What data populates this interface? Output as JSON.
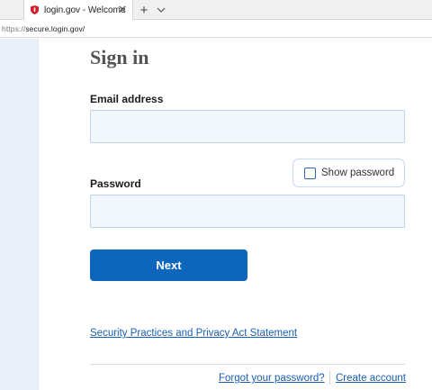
{
  "browser": {
    "tab_title": "login.gov - Welcome",
    "tab_close": "✕",
    "new_tab": "+",
    "url_scheme": "https://",
    "url_host": "secure.login.gov/"
  },
  "page": {
    "heading": "Sign in",
    "email_label": "Email address",
    "email_value": "",
    "password_label": "Password",
    "password_value": "",
    "show_password_label": "Show password",
    "next_button": "Next",
    "security_link": "Security Practices and Privacy Act Statement",
    "forgot_link": "Forgot your password?",
    "create_link": "Create account"
  },
  "colors": {
    "accent": "#0d66bc",
    "link": "#1a5fb4",
    "favicon": "#d11f2b",
    "input_bg": "#f1f7fd",
    "side_strip": "#eaf0f7"
  },
  "icons": {
    "favicon": "shield-icon",
    "tab_close": "close-icon",
    "new_tab": "plus-icon",
    "tab_list": "chevron-down-icon"
  }
}
